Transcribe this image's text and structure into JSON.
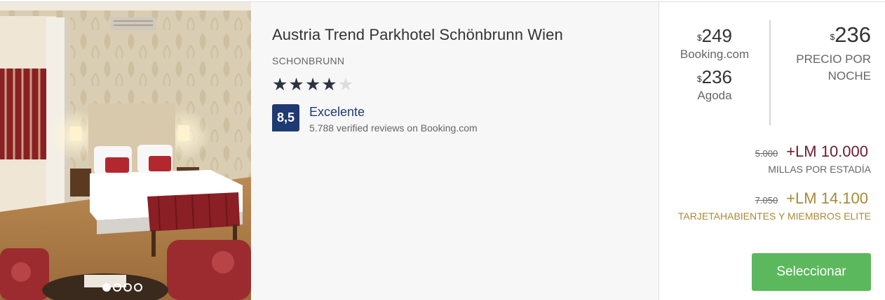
{
  "hotel": {
    "name": "Austria Trend Parkhotel Schönbrunn Wien",
    "area": "SCHONBRUNN",
    "stars": {
      "filled": 4,
      "total": 5
    },
    "rating": {
      "score": "8,5",
      "label": "Excelente",
      "reviews": "5.788 verified reviews on Booking.com"
    },
    "photo": {
      "slides": 4,
      "active_slide": 1
    }
  },
  "providers": [
    {
      "currency": "$",
      "price": "249",
      "name": "Booking.com"
    },
    {
      "currency": "$",
      "price": "236",
      "name": "Agoda"
    }
  ],
  "main_price": {
    "currency": "$",
    "price": "236",
    "label_line1": "PRECIO POR",
    "label_line2": "NOCHE"
  },
  "miles": [
    {
      "old": "5.000",
      "value": "+LM 10.000",
      "note": "MILLAS POR ESTADÍA"
    },
    {
      "old": "7.050",
      "value": "+LM 14.100",
      "note": "TARJETAHABIENTES Y MIEMBROS ELITE"
    }
  ],
  "actions": {
    "select_label": "Seleccionar"
  },
  "colors": {
    "rating_badge": "#1f3a72",
    "select_button": "#5cb85c",
    "miles_primary": "#6b1c2e",
    "miles_elite": "#a88a35"
  }
}
